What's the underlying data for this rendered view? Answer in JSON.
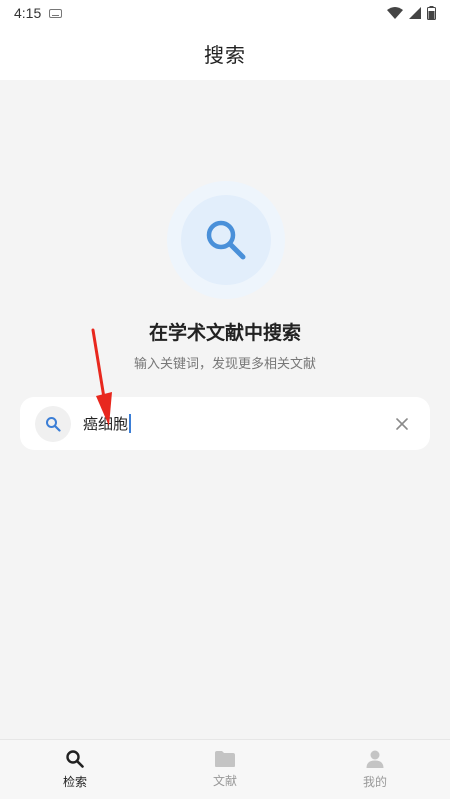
{
  "status_bar": {
    "time": "4:15"
  },
  "header": {
    "title": "搜索"
  },
  "hero": {
    "title": "在学术文献中搜索",
    "subtitle": "输入关键词，发现更多相关文献",
    "icon": "search-icon",
    "accent_color": "#4a90d9"
  },
  "search": {
    "value": "癌细胞",
    "icon": "search-icon",
    "clear_icon": "close-icon"
  },
  "bottom_nav": {
    "items": [
      {
        "label": "检索",
        "icon": "search-icon",
        "active": true
      },
      {
        "label": "文献",
        "icon": "folder-icon",
        "active": false
      },
      {
        "label": "我的",
        "icon": "person-icon",
        "active": false
      }
    ]
  }
}
